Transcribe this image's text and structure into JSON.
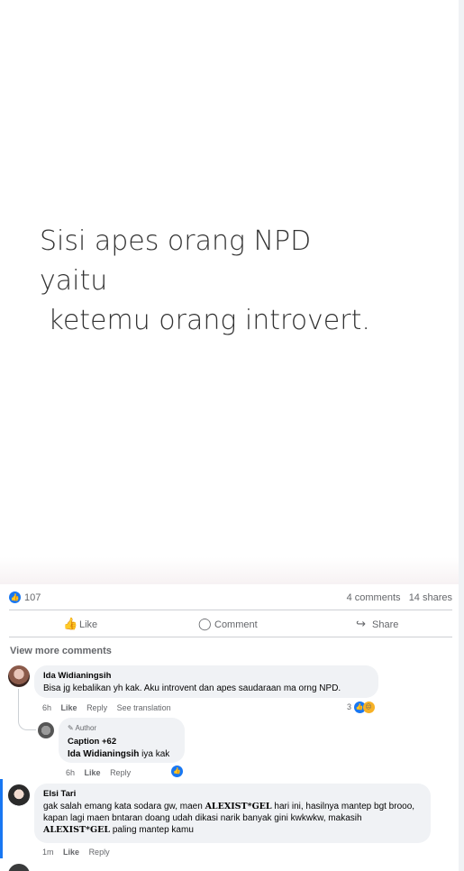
{
  "post": {
    "image_text": [
      "Sisi apes orang NPD",
      "yaitu",
      " ketemu orang introvert."
    ]
  },
  "stats": {
    "like_count": "107",
    "comments": "4 comments",
    "shares": "14 shares"
  },
  "actions": {
    "like": "Like",
    "comment": "Comment",
    "share": "Share"
  },
  "view_more": "View more comments",
  "comments": [
    {
      "name": "Ida Widianingsih",
      "text": "Bisa jg kebalikan yh kak. Aku introvent dan apes saudaraan ma orng NPD.",
      "time": "6h",
      "like": "Like",
      "reply": "Reply",
      "translate": "See translation",
      "reaction_count": "3"
    },
    {
      "author_tag": "Author",
      "name": "Caption +62",
      "mention": "Ida Widianingsih",
      "text": " iya kak",
      "time": "6h",
      "like": "Like",
      "reply": "Reply"
    },
    {
      "name": "Elsi Tari",
      "text_a": "gak salah emang kata sodara gw, maen ",
      "brand": "ALEXIST*GEL",
      "text_b": " hari ini, hasilnya mantep bgt brooo, kapan lagi maen bntaran doang udah dikasi narik banyak gini kwkwkw, makasih ",
      "brand2": "ALEXIST*GEL",
      "text_c": " paling mantep kamu",
      "time": "1m",
      "like": "Like",
      "reply": "Reply"
    }
  ],
  "colors": {
    "accent": "#1877f2",
    "bubble": "#f0f2f5",
    "muted": "#65676b"
  }
}
